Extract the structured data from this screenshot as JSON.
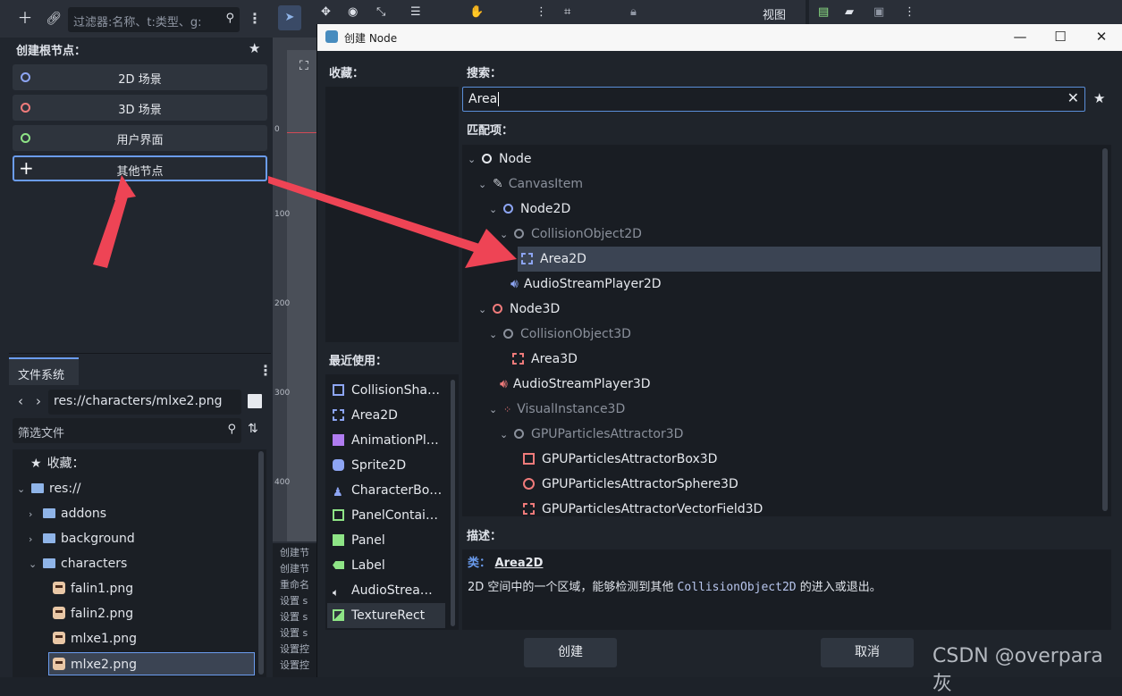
{
  "scene_dock": {
    "filter_placeholder": "过滤器:名称、t:类型、g:",
    "create_root_title": "创建根节点：",
    "root_buttons": [
      {
        "label": "2D 场景",
        "color": "#8da5f3"
      },
      {
        "label": "3D 场景",
        "color": "#f07b7b"
      },
      {
        "label": "用户界面",
        "color": "#8ee486"
      },
      {
        "label": "其他节点",
        "color": "#ffffff"
      }
    ]
  },
  "filesystem": {
    "tab_label": "文件系统",
    "path": "res://characters/mlxe2.png",
    "filter_placeholder": "筛选文件",
    "favorites_label": "收藏：",
    "tree": [
      {
        "label": "res://",
        "type": "folder"
      },
      {
        "label": "addons",
        "type": "folder"
      },
      {
        "label": "background",
        "type": "folder"
      },
      {
        "label": "characters",
        "type": "folder"
      },
      {
        "label": "falin1.png",
        "type": "png"
      },
      {
        "label": "falin2.png",
        "type": "png"
      },
      {
        "label": "mlxe1.png",
        "type": "png"
      },
      {
        "label": "mlxe2.png",
        "type": "png",
        "selected": true
      }
    ]
  },
  "viewport_ruler": [
    "0",
    "100",
    "200",
    "300",
    "400"
  ],
  "editor_toolbar": {
    "view_label": "视图"
  },
  "log_snippets": [
    "创建节",
    "创建节",
    "重命名",
    "设置 s",
    "设置 s",
    "设置 s",
    "设置控",
    "设置控",
    "设置控"
  ],
  "dialog": {
    "title": "创建 Node",
    "favorites_label": "收藏：",
    "recent_label": "最近使用：",
    "search_label": "搜索：",
    "search_value": "Area",
    "matches_label": "匹配项：",
    "description_label": "描述：",
    "class_prefix": "类：",
    "class_name": "Area2D",
    "description_text_1": "2D 空间中的一个区域，能够检测到其他 ",
    "description_code": "CollisionObject2D",
    "description_text_2": " 的进入或退出。",
    "create_button": "创建",
    "cancel_button": "取消",
    "tree": [
      {
        "label": "Node",
        "dim": false
      },
      {
        "label": "CanvasItem",
        "dim": true
      },
      {
        "label": "Node2D",
        "dim": false
      },
      {
        "label": "CollisionObject2D",
        "dim": true
      },
      {
        "label": "Area2D",
        "dim": false,
        "selected": true
      },
      {
        "label": "AudioStreamPlayer2D",
        "dim": false
      },
      {
        "label": "Node3D",
        "dim": false
      },
      {
        "label": "CollisionObject3D",
        "dim": true
      },
      {
        "label": "Area3D",
        "dim": false
      },
      {
        "label": "AudioStreamPlayer3D",
        "dim": false
      },
      {
        "label": "VisualInstance3D",
        "dim": true
      },
      {
        "label": "GPUParticlesAttractor3D",
        "dim": true
      },
      {
        "label": "GPUParticlesAttractorBox3D",
        "dim": false
      },
      {
        "label": "GPUParticlesAttractorSphere3D",
        "dim": false
      },
      {
        "label": "GPUParticlesAttractorVectorField3D",
        "dim": false
      }
    ],
    "recent": [
      {
        "label": "CollisionSha…",
        "color": "#8da5f3"
      },
      {
        "label": "Area2D",
        "color": "#8da5f3"
      },
      {
        "label": "AnimationPl…",
        "color": "#b07cf0"
      },
      {
        "label": "Sprite2D",
        "color": "#8da5f3"
      },
      {
        "label": "CharacterBo…",
        "color": "#8da5f3"
      },
      {
        "label": "PanelContai…",
        "color": "#8ee486"
      },
      {
        "label": "Panel",
        "color": "#8ee486"
      },
      {
        "label": "Label",
        "color": "#8ee486"
      },
      {
        "label": "AudioStrea…",
        "color": "#e6e9ee"
      },
      {
        "label": "TextureRect",
        "color": "#8ee486",
        "selected": true
      }
    ]
  },
  "watermark": "CSDN @overpara灰",
  "colors": {
    "accent": "#6b9cee",
    "arrow": "#ee4455",
    "node2d": "#8da5f3",
    "node3d": "#f07b7b",
    "control": "#8ee486"
  }
}
